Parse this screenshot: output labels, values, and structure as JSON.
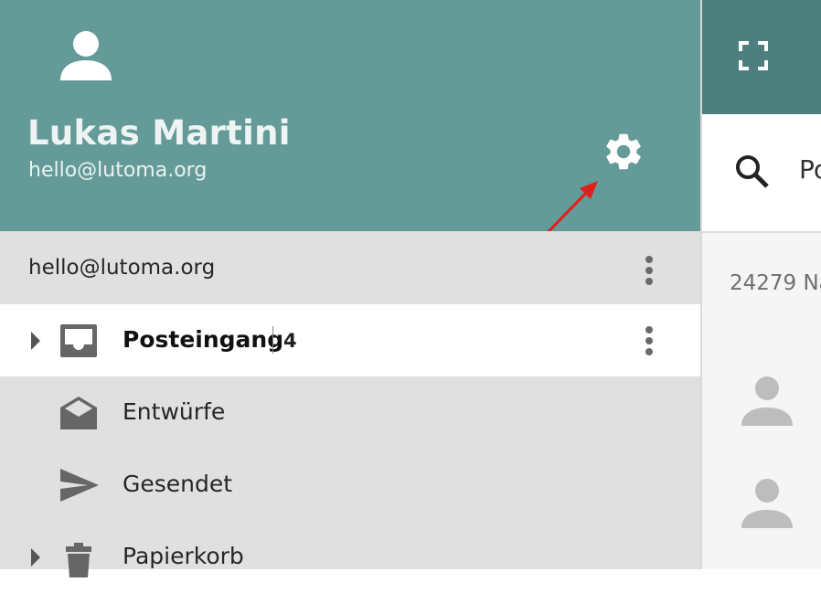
{
  "drawer": {
    "user_name": "Lukas Martini",
    "user_email": "hello@lutoma.org",
    "account_label": "hello@lutoma.org",
    "folders": [
      {
        "label": "Posteingang",
        "count": "4",
        "icon": "inbox-icon",
        "active": true,
        "expandable": true
      },
      {
        "label": "Entwürfe",
        "icon": "drafts-icon",
        "active": false,
        "expandable": false
      },
      {
        "label": "Gesendet",
        "icon": "send-icon",
        "active": false,
        "expandable": false
      },
      {
        "label": "Papierkorb",
        "icon": "trash-icon",
        "active": false,
        "expandable": true
      }
    ]
  },
  "right": {
    "search_value": "Po",
    "message_count": "24279 Na"
  },
  "colors": {
    "header": "#649b98",
    "topbar": "#4c7f7e",
    "drawer_bg": "#e0e0e0",
    "annotation": "#e0201c"
  }
}
